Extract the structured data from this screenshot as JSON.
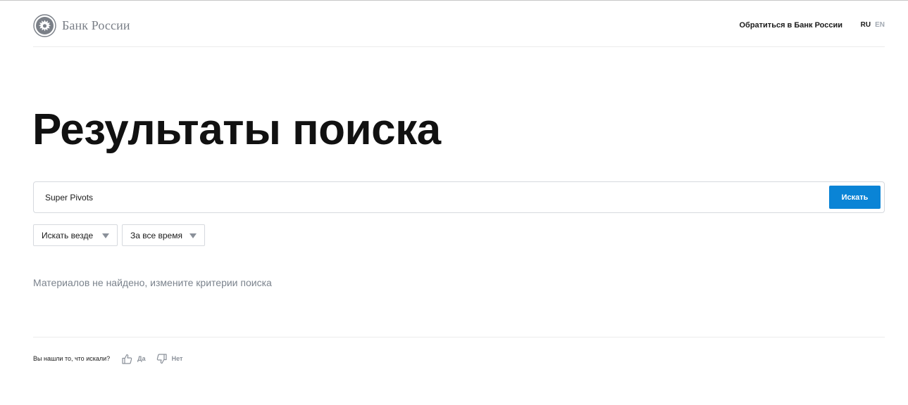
{
  "header": {
    "logo_text": "Банк России",
    "contact_link": "Обратиться в Банк России",
    "lang_ru": "RU",
    "lang_en": "EN"
  },
  "page_title": "Результаты поиска",
  "search": {
    "value": "Super Pivots",
    "button_label": "Искать"
  },
  "filters": {
    "where": "Искать везде",
    "time": "За все время"
  },
  "no_results": "Материалов не найдено, измените критерии поиска",
  "feedback": {
    "question": "Вы нашли то, что искали?",
    "yes": "Да",
    "no": "Нет"
  },
  "icons": {
    "logo": "bank-emblem-icon",
    "yes": "thumbs-up-icon",
    "no": "thumbs-down-icon",
    "dropdown": "triangle-down-icon"
  },
  "colors": {
    "accent": "#0a84d6",
    "muted_text": "#7b838d",
    "border": "#d6d9de"
  }
}
